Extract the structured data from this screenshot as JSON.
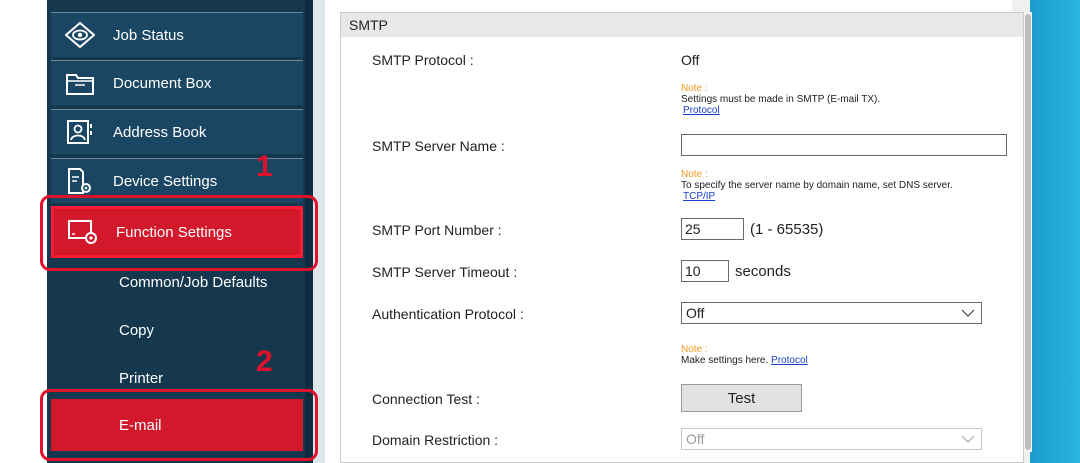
{
  "sidebar": {
    "items": [
      {
        "label": "Job Status",
        "icon": "eye-icon"
      },
      {
        "label": "Document Box",
        "icon": "folder-icon"
      },
      {
        "label": "Address Book",
        "icon": "address-book-icon"
      },
      {
        "label": "Device Settings",
        "icon": "device-settings-icon"
      },
      {
        "label": "Function Settings",
        "icon": "function-settings-icon"
      }
    ],
    "subitems": [
      {
        "label": "Common/Job Defaults"
      },
      {
        "label": "Copy"
      },
      {
        "label": "Printer"
      },
      {
        "label": "E-mail"
      }
    ],
    "step1": "1",
    "step2": "2"
  },
  "panel": {
    "title": "SMTP",
    "smtp_protocol": {
      "label": "SMTP Protocol :",
      "value": "Off"
    },
    "note1": {
      "prefix": "Note :",
      "text": "Settings must be made in SMTP (E-mail TX).",
      "link": "Protocol"
    },
    "server_name": {
      "label": "SMTP Server Name :",
      "value": ""
    },
    "note2": {
      "prefix": "Note :",
      "text": "To specify the server name by domain name, set DNS server.",
      "link": "TCP/IP"
    },
    "port": {
      "label": "SMTP Port Number :",
      "value": "25",
      "range": "(1 - 65535)"
    },
    "timeout": {
      "label": "SMTP Server Timeout :",
      "value": "10",
      "unit": "seconds"
    },
    "auth": {
      "label": "Authentication Protocol :",
      "value": "Off"
    },
    "note3": {
      "prefix": "Note :",
      "text": "Make settings here.",
      "link": "Protocol"
    },
    "connection": {
      "label": "Connection Test :",
      "button": "Test"
    },
    "domain": {
      "label": "Domain Restriction :",
      "value": "Off"
    }
  },
  "colors": {
    "accent": "#d2182b",
    "sidebar": "#16384f",
    "note": "#f39a1d",
    "link": "#1a3fd1"
  }
}
